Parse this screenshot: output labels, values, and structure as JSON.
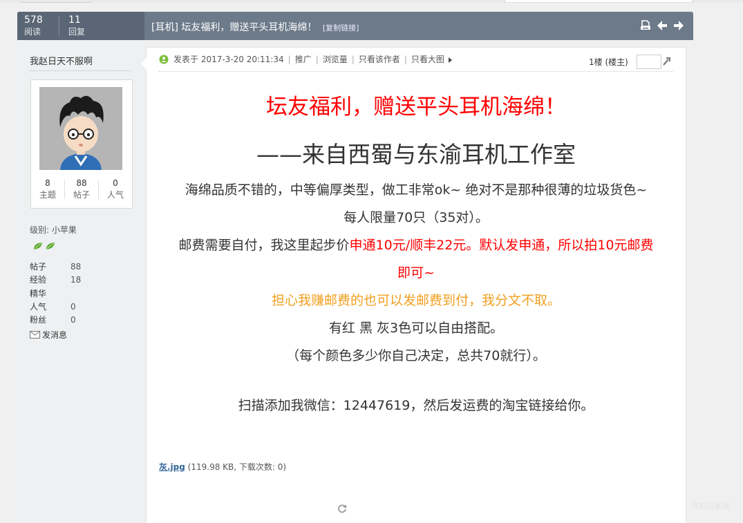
{
  "header": {
    "views_count": "578",
    "views_label": "阅读",
    "replies_count": "11",
    "replies_label": "回复",
    "title": "[耳机] 坛友福利，赠送平头耳机海绵！",
    "copy_link": "[复制链接]",
    "icons": [
      "print-icon",
      "prev-thread-icon",
      "next-thread-icon"
    ]
  },
  "author": {
    "name": "我赵日天不服啊",
    "threads_value": "8",
    "threads_label": "主题",
    "posts_value": "88",
    "posts_label": "帖子",
    "popularity_value": "0",
    "popularity_label": "人气",
    "level_prefix": "级别: ",
    "level_name": "小苹果",
    "profile": [
      {
        "key": "帖子",
        "value": "88"
      },
      {
        "key": "经验",
        "value": "18"
      },
      {
        "key": "精华",
        "value": ""
      },
      {
        "key": "人气",
        "value": "0"
      },
      {
        "key": "粉丝",
        "value": "0"
      }
    ],
    "send_message": "发消息"
  },
  "post_meta": {
    "posted": "发表于 2017-3-20 20:11:34",
    "promote": "推广",
    "views": "浏览量",
    "author_only": "只看该作者",
    "large_image": "只看大图",
    "floor": "1楼 (楼主)"
  },
  "content": {
    "title": "坛友福利，赠送平头耳机海绵！",
    "subtitle": "——来自西蜀与东渝耳机工作室",
    "line1": "海绵品质不错的，中等偏厚类型，做工非常ok~ 绝对不是那种很薄的垃圾货色~",
    "line2": "每人限量70只（35对）。",
    "line3_plain": "邮费需要自付，我这里起步价",
    "line3_red": "申通10元/顺丰22元。默认发申通，所以拍10元邮费",
    "line3_cont": "即可~",
    "line4": "担心我赚邮费的也可以发邮费到付，我分文不取。",
    "line5": "有红 黑 灰3色可以自由搭配。",
    "line6": "（每个颜色多少你自己决定，总共70就行）。",
    "line7": "扫描添加我微信：12447619，然后发运费的淘宝链接给你。"
  },
  "attachment": {
    "name": "灰.jpg",
    "info": " (119.98 KB, 下载次数: 0)"
  },
  "watermark": "耳机玩家网",
  "colors": {
    "header_bg": "#6c7a8a",
    "title_red": "#ff0000",
    "note_orange": "#f0a020",
    "link_blue": "#336699"
  }
}
